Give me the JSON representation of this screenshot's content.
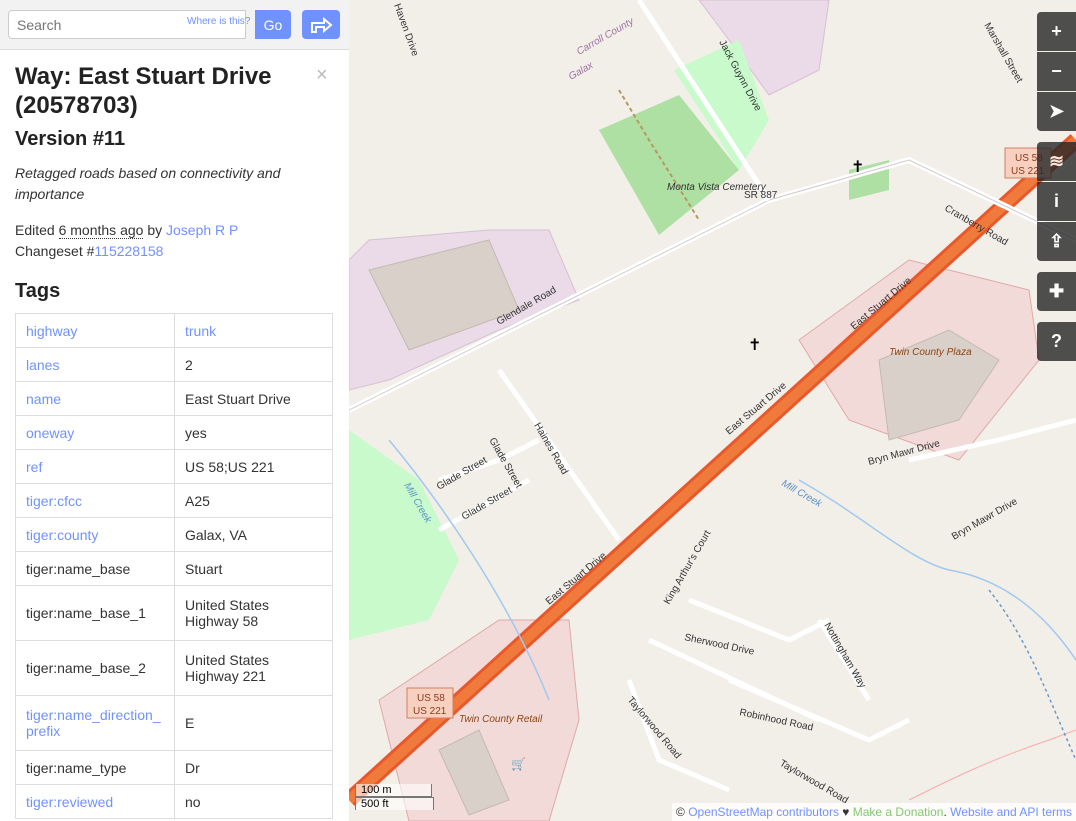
{
  "search": {
    "placeholder": "Search",
    "where_is": "Where is this?",
    "go_label": "Go"
  },
  "feature": {
    "title": "Way: East Stuart Drive (20578703)",
    "version": "Version #11",
    "comment": "Retagged roads based on connectivity and importance",
    "edited_prefix": "Edited ",
    "edited_ago": "6 months ago",
    "by": " by ",
    "user": "Joseph R P",
    "changeset_prefix": "Changeset #",
    "changeset_id": "115228158",
    "tags_heading": "Tags"
  },
  "tags": [
    {
      "key": "highway",
      "value": "trunk",
      "key_link": true,
      "value_link": true
    },
    {
      "key": "lanes",
      "value": "2",
      "key_link": true,
      "value_link": false
    },
    {
      "key": "name",
      "value": "East Stuart Drive",
      "key_link": true,
      "value_link": false
    },
    {
      "key": "oneway",
      "value": "yes",
      "key_link": true,
      "value_link": false
    },
    {
      "key": "ref",
      "value": "US 58;US 221",
      "key_link": true,
      "value_link": false
    },
    {
      "key": "tiger:cfcc",
      "value": "A25",
      "key_link": true,
      "value_link": false
    },
    {
      "key": "tiger:county",
      "value": "Galax, VA",
      "key_link": true,
      "value_link": false
    },
    {
      "key": "tiger:name_base",
      "value": "Stuart",
      "key_link": false,
      "value_link": false
    },
    {
      "key": "tiger:name_base_1",
      "value": "United States Highway 58",
      "key_link": false,
      "value_link": false
    },
    {
      "key": "tiger:name_base_2",
      "value": "United States Highway 221",
      "key_link": false,
      "value_link": false
    },
    {
      "key": "tiger:name_direction_prefix",
      "value": "E",
      "key_link": true,
      "value_link": false
    },
    {
      "key": "tiger:name_type",
      "value": "Dr",
      "key_link": false,
      "value_link": false
    },
    {
      "key": "tiger:reviewed",
      "value": "no",
      "key_link": true,
      "value_link": false
    }
  ],
  "map_labels": {
    "carroll_county": "Carroll County",
    "galax": "Galax",
    "haven_drive": "Haven Drive",
    "jack_guynn": "Jack Guynn Drive",
    "monta_vista": "Monta Vista Cemetery",
    "sr887": "SR 887",
    "glendale": "Glendale Road",
    "marshall": "Marshall Street",
    "cranberry": "Cranberry Road",
    "east_stuart_1": "East Stuart Drive",
    "east_stuart_2": "East Stuart Drive",
    "east_stuart_3": "East Stuart Drive",
    "twin_county_plaza": "Twin County Plaza",
    "twin_county_retail": "Twin County Retail",
    "glade_street_1": "Glade Street",
    "glade_street_2": "Glade Street",
    "glade_street_3": "Glade Street",
    "haines": "Haines Road",
    "mill_creek_1": "Mill Creek",
    "mill_creek_2": "Mill Creek",
    "bryn_mawr_1": "Bryn Mawr Drive",
    "bryn_mawr_2": "Bryn Mawr Drive",
    "king_arthur": "King Arthur's Court",
    "nottingham": "Nottingham Way",
    "sherwood": "Sherwood Drive",
    "robinhood": "Robinhood Road",
    "taylorwood_1": "Taylorwood Road",
    "taylorwood_2": "Taylorwood Road",
    "us58": "US 58",
    "us221": "US 221"
  },
  "scale": {
    "metric": "100 m",
    "imperial": "500 ft"
  },
  "attribution": {
    "copy": "© ",
    "osm": "OpenStreetMap contributors",
    "heart": " ♥ ",
    "donate": "Make a Donation",
    "dot": ". ",
    "api": "Website and API terms"
  },
  "controls": [
    "zoom-in",
    "zoom-out",
    "locate",
    "layers",
    "info",
    "share",
    "note",
    "query"
  ]
}
